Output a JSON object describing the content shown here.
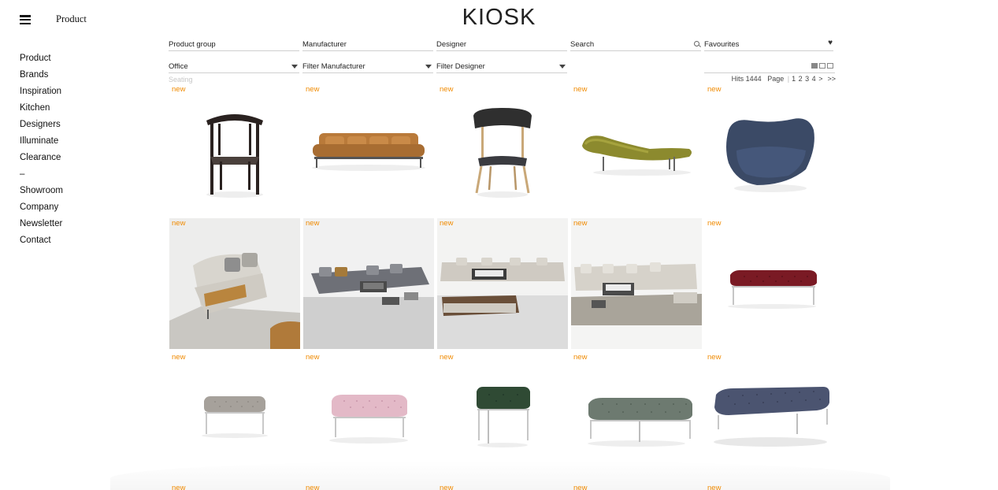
{
  "header": {
    "menu_icon": "hamburger-icon",
    "section": "Product",
    "logo": "KIOSK"
  },
  "nav": [
    "Product",
    "Brands",
    "Inspiration",
    "Kitchen",
    "Designers",
    "Illuminate",
    "Clearance",
    "–",
    "Showroom",
    "Company",
    "Newsletter",
    "Contact"
  ],
  "filters": {
    "labels": [
      "Product group",
      "Manufacturer",
      "Designer",
      "Search",
      "Favourites"
    ],
    "values": [
      "Office",
      "Filter Manufacturer",
      "Filter Designer"
    ],
    "sub": "Seating"
  },
  "results": {
    "hits": "Hits 1444",
    "page_label": "Page",
    "pages": [
      "1",
      "2",
      "3",
      "4"
    ],
    "next": ">",
    "last": ">>"
  },
  "badge": "new",
  "products": [
    {
      "badge": "new",
      "kind": "chair-dark"
    },
    {
      "badge": "new",
      "kind": "sofa-tan"
    },
    {
      "badge": "new",
      "kind": "chair-wood"
    },
    {
      "badge": "new",
      "kind": "chaise-green"
    },
    {
      "badge": "new",
      "kind": "armchair-blue"
    },
    {
      "badge": "new",
      "kind": "sofa-scene"
    },
    {
      "badge": "new",
      "kind": "sectional-scene"
    },
    {
      "badge": "new",
      "kind": "sectional-scene-2"
    },
    {
      "badge": "new",
      "kind": "sectional-scene-3"
    },
    {
      "badge": "new",
      "kind": "bench-red"
    },
    {
      "badge": "new",
      "kind": "ottoman-grey"
    },
    {
      "badge": "new",
      "kind": "ottoman-pink"
    },
    {
      "badge": "new",
      "kind": "stool-green"
    },
    {
      "badge": "new",
      "kind": "ottoman-sage"
    },
    {
      "badge": "new",
      "kind": "ottoman-navy"
    }
  ],
  "next_row_badges": [
    "new",
    "new",
    "new",
    "new",
    "new"
  ],
  "colors": {
    "badge": "#f08a00",
    "rule": "#cfcfcf"
  }
}
